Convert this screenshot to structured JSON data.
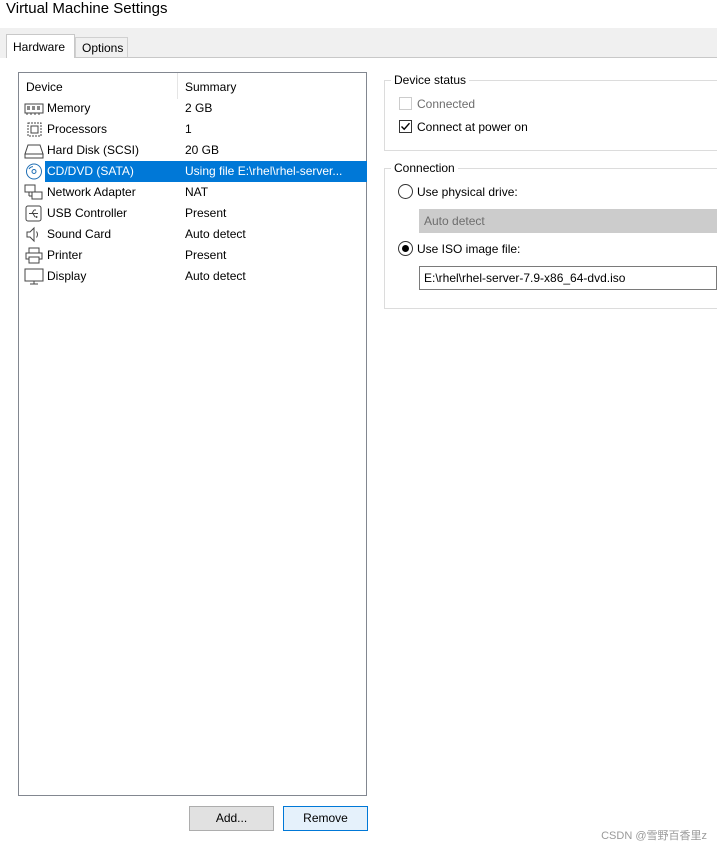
{
  "window": {
    "title": "Virtual Machine Settings"
  },
  "tabs": [
    {
      "label": "Hardware",
      "selected": true
    },
    {
      "label": "Options",
      "selected": false
    }
  ],
  "device_list": {
    "headers": {
      "device": "Device",
      "summary": "Summary"
    },
    "rows": [
      {
        "icon": "memory-icon",
        "device": "Memory",
        "summary": "2 GB"
      },
      {
        "icon": "processor-icon",
        "device": "Processors",
        "summary": "1"
      },
      {
        "icon": "hard-disk-icon",
        "device": "Hard Disk (SCSI)",
        "summary": "20 GB"
      },
      {
        "icon": "cd-dvd-icon",
        "device": "CD/DVD (SATA)",
        "summary": "Using file E:\\rhel\\rhel-server...",
        "selected": true
      },
      {
        "icon": "network-adapter-icon",
        "device": "Network Adapter",
        "summary": "NAT"
      },
      {
        "icon": "usb-icon",
        "device": "USB Controller",
        "summary": "Present"
      },
      {
        "icon": "speaker-icon",
        "device": "Sound Card",
        "summary": "Auto detect"
      },
      {
        "icon": "printer-icon",
        "device": "Printer",
        "summary": "Present"
      },
      {
        "icon": "display-icon",
        "device": "Display",
        "summary": "Auto detect"
      }
    ]
  },
  "buttons": {
    "add": "Add...",
    "remove": "Remove"
  },
  "device_status": {
    "legend": "Device status",
    "connected": {
      "label": "Connected",
      "checked": false,
      "enabled": false
    },
    "connect_at_power_on": {
      "label": "Connect at power on",
      "checked": true
    }
  },
  "connection": {
    "legend": "Connection",
    "physical_drive": {
      "label": "Use physical drive:",
      "selected": false
    },
    "physical_drive_value": "Auto detect",
    "iso_image": {
      "label": "Use ISO image file:",
      "selected": true
    },
    "iso_path": "E:\\rhel\\rhel-server-7.9-x86_64-dvd.iso"
  },
  "watermark": "CSDN @雪野百香里z",
  "colors": {
    "selection": "#0078d7",
    "disabled_field": "#cccccc"
  }
}
